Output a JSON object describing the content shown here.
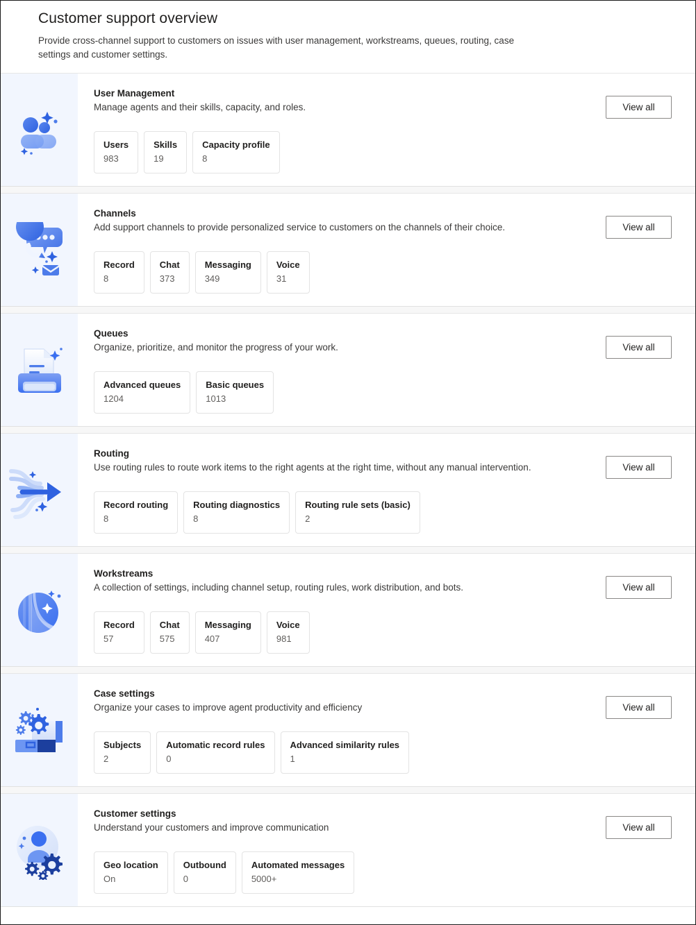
{
  "page": {
    "title": "Customer support overview",
    "subtitle": "Provide cross-channel support to customers on issues with user management, workstreams, queues, routing, case settings and customer settings."
  },
  "common": {
    "view_all_label": "View all"
  },
  "theme": {
    "accent": "#3a6ff0",
    "art_background": "#f2f6fe",
    "card_background": "#ffffff",
    "page_background": "#f7f7f7",
    "title_color": "#201f1e",
    "muted_text": "#605e5c"
  },
  "cards": [
    {
      "icon": "people-icon",
      "title": "User Management",
      "description": "Manage agents and their skills, capacity, and roles.",
      "action_label": "View all",
      "stats": [
        {
          "label": "Users",
          "value": "983"
        },
        {
          "label": "Skills",
          "value": "19"
        },
        {
          "label": "Capacity profile",
          "value": "8"
        }
      ]
    },
    {
      "icon": "chat-phone-mail-icon",
      "title": "Channels",
      "description": "Add support channels to provide personalized service to customers on the channels of their choice.",
      "action_label": "View all",
      "stats": [
        {
          "label": "Record",
          "value": "8"
        },
        {
          "label": "Chat",
          "value": "373"
        },
        {
          "label": "Messaging",
          "value": "349"
        },
        {
          "label": "Voice",
          "value": "31"
        }
      ]
    },
    {
      "icon": "printer-document-icon",
      "title": "Queues",
      "description": "Organize, prioritize, and monitor the progress of your work.",
      "action_label": "View all",
      "stats": [
        {
          "label": "Advanced queues",
          "value": "1204"
        },
        {
          "label": "Basic queues",
          "value": "1013"
        }
      ]
    },
    {
      "icon": "routing-arrow-icon",
      "title": "Routing",
      "description": "Use routing rules to route work items to the right agents at the right time, without any manual intervention.",
      "action_label": "View all",
      "stats": [
        {
          "label": "Record routing",
          "value": "8"
        },
        {
          "label": "Routing diagnostics",
          "value": "8"
        },
        {
          "label": "Routing rule sets (basic)",
          "value": "2"
        }
      ]
    },
    {
      "icon": "workstream-sphere-icon",
      "title": "Workstreams",
      "description": "A collection of settings, including channel setup, routing rules, work distribution, and bots.",
      "action_label": "View all",
      "stats": [
        {
          "label": "Record",
          "value": "57"
        },
        {
          "label": "Chat",
          "value": "575"
        },
        {
          "label": "Messaging",
          "value": "407"
        },
        {
          "label": "Voice",
          "value": "981"
        }
      ]
    },
    {
      "icon": "case-gears-icon",
      "title": "Case settings",
      "description": "Organize your cases to improve agent productivity and efficiency",
      "action_label": "View all",
      "stats": [
        {
          "label": "Subjects",
          "value": "2"
        },
        {
          "label": "Automatic record rules",
          "value": "0"
        },
        {
          "label": "Advanced similarity rules",
          "value": "1"
        }
      ]
    },
    {
      "icon": "customer-gears-icon",
      "title": "Customer settings",
      "description": "Understand your customers and improve communication",
      "action_label": "View all",
      "stats": [
        {
          "label": "Geo location",
          "value": "On"
        },
        {
          "label": "Outbound",
          "value": "0"
        },
        {
          "label": "Automated messages",
          "value": "5000+"
        }
      ]
    }
  ]
}
